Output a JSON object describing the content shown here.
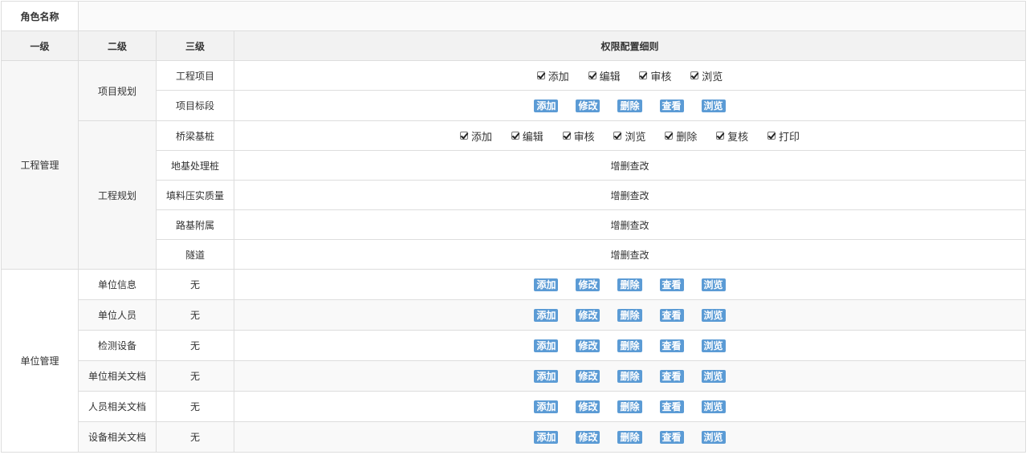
{
  "role_name_label": "角色名称",
  "role_name_value": "",
  "headers": {
    "level1": "一级",
    "level2": "二级",
    "level3": "三级",
    "detail": "权限配置细则"
  },
  "checkbox_labels_basic": [
    "添加",
    "编辑",
    "审核",
    "浏览"
  ],
  "checkbox_labels_extended": [
    "添加",
    "编辑",
    "审核",
    "浏览",
    "删除",
    "复核",
    "打印"
  ],
  "button_labels": [
    "添加",
    "修改",
    "删除",
    "查看",
    "浏览"
  ],
  "crud_text": "增删查改",
  "none_text": "无",
  "engineering": {
    "name": "工程管理",
    "project_planning": {
      "name": "项目规划",
      "item1": "工程项目",
      "item2": "项目标段"
    },
    "engineering_planning": {
      "name": "工程规划",
      "item1": "桥梁基桩",
      "item2": "地基处理桩",
      "item3": "填料压实质量",
      "item4": "路基附属",
      "item5": "隧道"
    }
  },
  "unit": {
    "name": "单位管理",
    "rows": [
      "单位信息",
      "单位人员",
      "检测设备",
      "单位相关文档",
      "人员相关文档",
      "设备相关文档"
    ]
  },
  "colors": {
    "button": "#5b9bd5",
    "border": "#dddddd",
    "header_bg": "#f2f2f2"
  }
}
